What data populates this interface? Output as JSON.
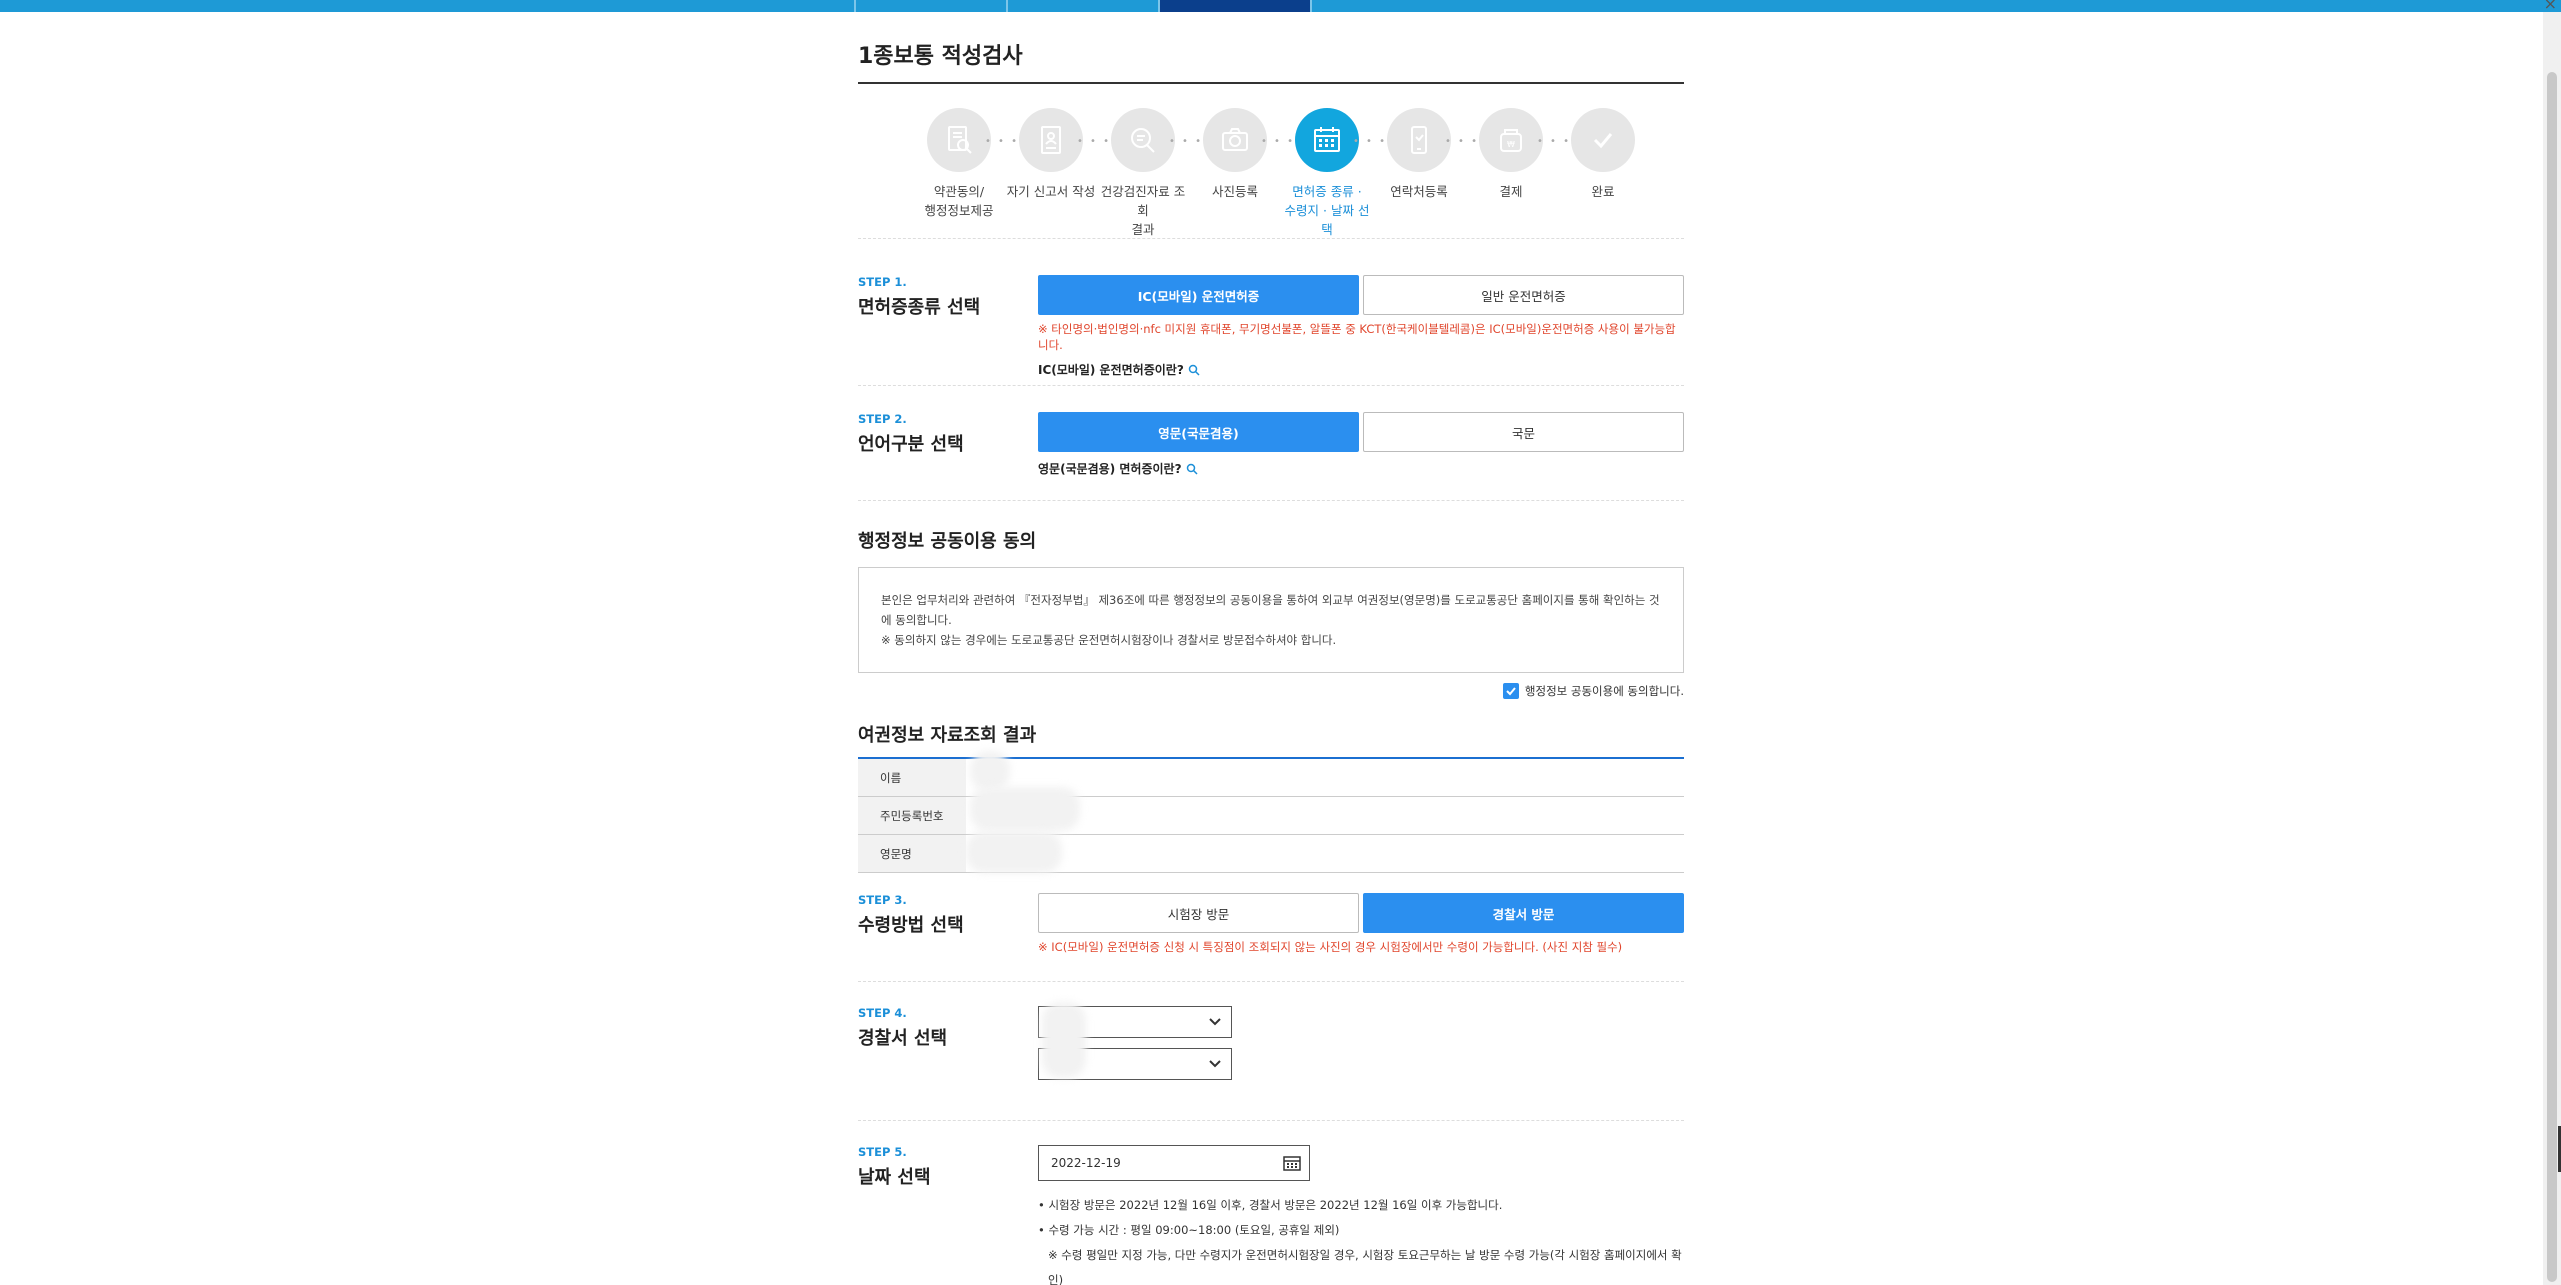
{
  "page": {
    "title": "1종보통 적성검사"
  },
  "progress": [
    {
      "label": "약관동의/\n행정정보제공",
      "icon": "document-search-icon"
    },
    {
      "label": "자기 신고서 작성",
      "icon": "id-card-icon"
    },
    {
      "label": "건강검진자료 조회\n결과",
      "icon": "magnifier-document-icon"
    },
    {
      "label": "사진등록",
      "icon": "camera-icon"
    },
    {
      "label": "면허증 종류 ·\n수령지 · 날짜 선택",
      "icon": "calendar-icon",
      "active": true
    },
    {
      "label": "연락처등록",
      "icon": "phone-icon"
    },
    {
      "label": "결제",
      "icon": "payment-icon"
    },
    {
      "label": "완료",
      "icon": "check-icon"
    }
  ],
  "step1": {
    "tag": "STEP 1.",
    "title": "면허증종류 선택",
    "options": [
      "IC(모바일) 운전면허증",
      "일반 운전면허증"
    ],
    "selected": 0,
    "notice": "※ 타인명의·법인명의·nfc 미지원 휴대폰, 무기명선불폰, 알뜰폰 중 KCT(한국케이블텔레콤)은 IC(모바일)운전면허증 사용이 불가능합니다.",
    "info_link": "IC(모바일) 운전면허증이란?"
  },
  "step2": {
    "tag": "STEP 2.",
    "title": "언어구분 선택",
    "options": [
      "영문(국문겸용)",
      "국문"
    ],
    "selected": 0,
    "info_link": "영문(국문겸용) 면허증이란?"
  },
  "admin_consent": {
    "title": "행정정보 공동이용 동의",
    "text1": "본인은 업무처리와 관련하여 『전자정부법』 제36조에 따른 행정정보의 공동이용을 통하여 외교부 여권정보(영문명)를 도로교통공단 홈페이지를 통해 확인하는 것에 동의합니다.",
    "text2": "※ 동의하지 않는 경우에는 도로교통공단 운전면허시험장이나 경찰서로 방문접수하셔야 합니다.",
    "checkbox_label": "행정정보 공동이용에 동의합니다.",
    "checked": true
  },
  "passport": {
    "title": "여권정보 자료조회 결과",
    "rows": [
      "이름",
      "주민등록번호",
      "영문명"
    ]
  },
  "step3": {
    "tag": "STEP 3.",
    "title": "수령방법 선택",
    "options": [
      "시험장 방문",
      "경찰서 방문"
    ],
    "selected": 1,
    "notice": "※ IC(모바일) 운전면허증 신청 시 특징점이 조회되지 않는 사진의 경우 시험장에서만 수령이 가능합니다. (사진 지참 필수)"
  },
  "step4": {
    "tag": "STEP 4.",
    "title": "경찰서 선택"
  },
  "step5": {
    "tag": "STEP 5.",
    "title": "날짜 선택",
    "date_value": "2022-12-19",
    "note1": "시험장 방문은 2022년 12월 16일 이후, 경찰서 방문은 2022년 12월 16일 이후 가능합니다.",
    "note2": "수령 가능 시간 : 평일 09:00~18:00 (토요일, 공휴일 제외)",
    "note3": "※ 수령 평일만 지정 가능, 다만 수령지가 운전면허시험장일 경우, 시험장 토요근무하는 날 방문 수령 가능(각 시험장 홈페이지에서 확인)"
  },
  "colors": {
    "accent": "#2b8fef",
    "active_step": "#12a6de",
    "notice": "#e0452c",
    "topbar": "#1e9ad6"
  }
}
